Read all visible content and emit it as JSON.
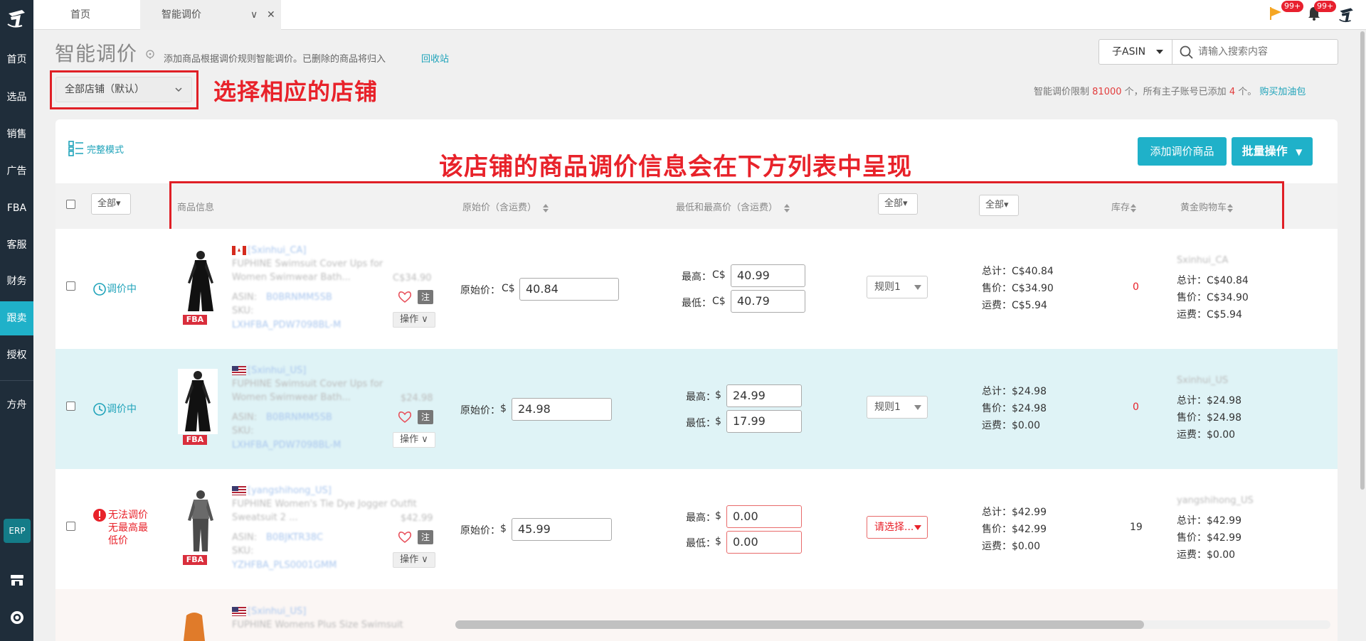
{
  "sidebar": {
    "items": [
      {
        "label": "首页"
      },
      {
        "label": "选品"
      },
      {
        "label": "销售"
      },
      {
        "label": "广告"
      },
      {
        "label": "FBA"
      },
      {
        "label": "客服"
      },
      {
        "label": "财务"
      },
      {
        "label": "跟卖"
      },
      {
        "label": "授权"
      },
      {
        "label": "方舟"
      }
    ],
    "active": "跟卖",
    "erp_label": "ERP"
  },
  "tabs": {
    "home": "首页",
    "current": "智能调价",
    "current_chevron": "∨",
    "close": "✕"
  },
  "notifications": {
    "flag_badge": "99+",
    "bell_badge": "99+"
  },
  "page": {
    "title": "智能调价",
    "description": "添加商品根据调价规则智能调价。已删除的商品将归入",
    "recycle_link": "回收站",
    "store_select": "全部店铺（默认）",
    "limit_prefix": "智能调价限制",
    "limit_value": "81000",
    "limit_mid": "个，所有主子账号已添加",
    "added_value": "4",
    "limit_suffix": "个。",
    "buy_link": "购买加油包",
    "full_mode": "完整模式",
    "add_button": "添加调价商品",
    "batch_button": "批量操作",
    "batch_caret": "▼"
  },
  "search": {
    "type_label": "子ASIN",
    "placeholder": "请输入搜索内容"
  },
  "annotations": {
    "store": "选择相应的店铺",
    "list": "该店铺的商品调价信息会在下方列表中呈现"
  },
  "table": {
    "headers": {
      "filter_all": "全部▾",
      "product_info": "商品信息",
      "original_price": "原始价（含运费）",
      "min_max_price": "最低和最高价（含运费）",
      "rule_filter": "全部▾",
      "status_filter": "全部▾",
      "stock": "库存",
      "buybox": "黄金购物车"
    },
    "labels": {
      "original": "原始价：",
      "max": "最高：",
      "min": "最低：",
      "total": "总计：",
      "sale": "售价：",
      "shipping": "运费：",
      "asin": "ASIN:",
      "sku": "SKU:",
      "note": "注",
      "op": "操作 ∨",
      "fba": "FBA"
    },
    "rows": [
      {
        "status": "调价中",
        "store": "[Sxinhui_CA]",
        "title1": "FUPHINE Swimsuit Cover Ups for",
        "title2": "Women Swimwear Bath...",
        "old_price": "C$34.90",
        "asin": "B0BRNMM5SB",
        "sku": "LXHFBA_PDW7098BL-M",
        "currency": "C$",
        "original_price": "40.84",
        "max": "40.99",
        "min": "40.79",
        "rule": "规则1",
        "total": "C$40.84",
        "sale": "C$34.90",
        "shipping": "C$5.94",
        "stock": "0",
        "bb_store": "Sxinhui_CA",
        "bb_total": "C$40.84",
        "bb_sale": "C$34.90",
        "bb_shipping": "C$5.94"
      },
      {
        "status": "调价中",
        "store": "[Sxinhui_US]",
        "title1": "FUPHINE Swimsuit Cover Ups for",
        "title2": "Women Swimwear Bath...",
        "old_price": "$24.98",
        "asin": "B0BRNMM5SB",
        "sku": "LXHFBA_PDW7098BL-M",
        "currency": "$",
        "original_price": "24.98",
        "max": "24.99",
        "min": "17.99",
        "rule": "规则1",
        "total": "$24.98",
        "sale": "$24.98",
        "shipping": "$0.00",
        "stock": "0",
        "bb_store": "Sxinhui_US",
        "bb_total": "$24.98",
        "bb_sale": "$24.98",
        "bb_shipping": "$0.00"
      },
      {
        "status_lines": [
          "无法调价",
          "无最高最",
          "低价"
        ],
        "store": "[yangshihong_US]",
        "title1": "FUPHINE Women's Tie Dye Jogger Outfit",
        "title2": "Sweatsuit 2 ...",
        "old_price": "$42.99",
        "asin": "B0BJKTR38C",
        "sku": "YZHFBA_PLS0001GMM",
        "currency": "$",
        "original_price": "45.99",
        "max": "0.00",
        "min": "0.00",
        "rule": "请选择...",
        "total": "$42.99",
        "sale": "$42.99",
        "shipping": "$0.00",
        "stock": "19",
        "bb_store": "yangshihong_US",
        "bb_total": "$42.99",
        "bb_sale": "$42.99",
        "bb_shipping": "$0.00"
      },
      {
        "store": "[Sxinhui_US]",
        "title1": "FUPHINE Womens Plus Size Swimsuit"
      }
    ]
  },
  "colors": {
    "sidebar": "#1f2d3a",
    "accent": "#1fb1c9",
    "annotation": "#e8222a",
    "highlight_row": "#dff3f6"
  }
}
